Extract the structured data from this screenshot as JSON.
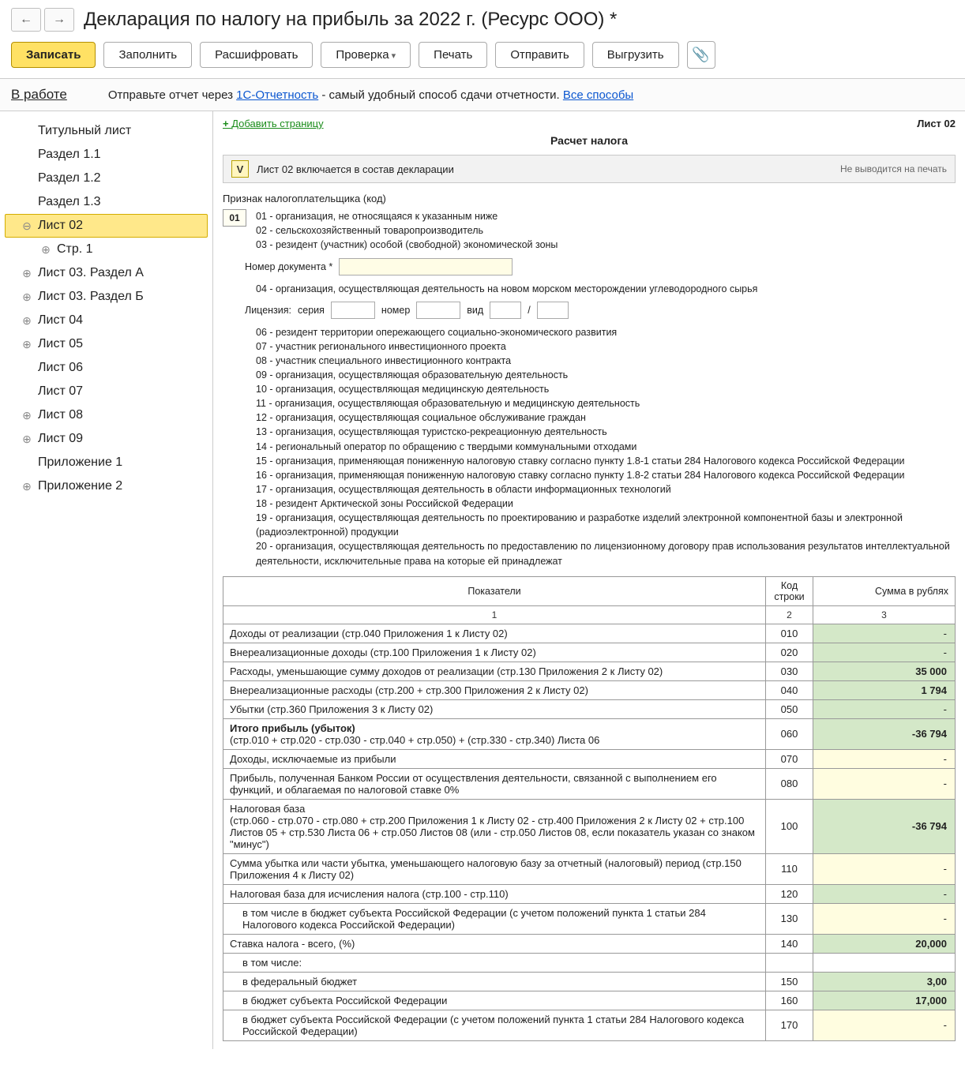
{
  "title": "Декларация по налогу на прибыль за 2022 г. (Ресурс ООО) *",
  "toolbar": {
    "write": "Записать",
    "fill": "Заполнить",
    "decode": "Расшифровать",
    "check": "Проверка",
    "print": "Печать",
    "send": "Отправить",
    "export": "Выгрузить"
  },
  "status": "В работе",
  "infobar": {
    "prefix": "Отправьте отчет через ",
    "link1": "1С-Отчетность",
    "middle": " - самый удобный способ сдачи отчетности. ",
    "link2": "Все способы"
  },
  "tree": [
    {
      "label": "Титульный лист",
      "exp": "",
      "lvl": 1
    },
    {
      "label": "Раздел 1.1",
      "exp": "",
      "lvl": 1
    },
    {
      "label": "Раздел 1.2",
      "exp": "",
      "lvl": 1
    },
    {
      "label": "Раздел 1.3",
      "exp": "",
      "lvl": 1
    },
    {
      "label": "Лист 02",
      "exp": "minus",
      "lvl": 1,
      "selected": true
    },
    {
      "label": "Стр. 1",
      "exp": "plus",
      "lvl": 2
    },
    {
      "label": "Лист 03. Раздел А",
      "exp": "plus",
      "lvl": 1
    },
    {
      "label": "Лист 03. Раздел Б",
      "exp": "plus",
      "lvl": 1
    },
    {
      "label": "Лист 04",
      "exp": "plus",
      "lvl": 1
    },
    {
      "label": "Лист 05",
      "exp": "plus",
      "lvl": 1
    },
    {
      "label": "Лист 06",
      "exp": "",
      "lvl": 1
    },
    {
      "label": "Лист 07",
      "exp": "",
      "lvl": 1
    },
    {
      "label": "Лист 08",
      "exp": "plus",
      "lvl": 1
    },
    {
      "label": "Лист 09",
      "exp": "plus",
      "lvl": 1
    },
    {
      "label": "Приложение 1",
      "exp": "",
      "lvl": 1
    },
    {
      "label": "Приложение 2",
      "exp": "plus",
      "lvl": 1
    }
  ],
  "main": {
    "addPage": "Добавить страницу",
    "sheet": "Лист 02",
    "calcTitle": "Расчет налога",
    "includeText": "Лист 02 включается в состав декларации",
    "noPrint": "Не выводится на печать",
    "taxpayerLabel": "Признак налогоплательщика (код)",
    "code": "01",
    "codeLines": [
      "01 - организация, не относящаяся к указанным ниже",
      "02 - сельскохозяйственный товаропроизводитель",
      "03 - резидент (участник) особой (свободной) экономической зоны"
    ],
    "docNumLabel": "Номер документа *",
    "line04": "04 - организация, осуществляющая деятельность на новом морском месторождении углеводородного сырья",
    "license": {
      "label": "Лицензия:",
      "series": "серия",
      "number": "номер",
      "type": "вид",
      "slash": "/"
    },
    "restLines": [
      "06 - резидент территории опережающего социально-экономического развития",
      "07 - участник регионального инвестиционного проекта",
      "08 - участник специального инвестиционного контракта",
      "09 - организация, осуществляющая образовательную деятельность",
      "10 - организация, осуществляющая медицинскую деятельность",
      "11 - организация, осуществляющая образовательную и медицинскую деятельность",
      "12 - организация, осуществляющая социальное обслуживание граждан",
      "13 - организация, осуществляющая туристско-рекреационную деятельность",
      "14 - региональный оператор по обращению с твердыми коммунальными отходами",
      "15 - организация, применяющая пониженную налоговую ставку согласно пункту 1.8-1 статьи 284 Налогового кодекса Российской Федерации",
      "16 - организация, применяющая пониженную налоговую ставку согласно пункту 1.8-2 статьи 284 Налогового кодекса Российской Федерации",
      "17 - организация, осуществляющая деятельность в области информационных технологий",
      "18 - резидент Арктической зоны Российской Федерации",
      "19 - организация, осуществляющая деятельность по проектированию и разработке изделий электронной компонентной базы и электронной (радиоэлектронной) продукции",
      "20 - организация, осуществляющая деятельность по предоставлению по лицензионному договору прав использования результатов интеллектуальной деятельности, исключительные права на которые ей принадлежат"
    ],
    "table": {
      "headers": {
        "ind": "Показатели",
        "code": "Код строки",
        "sum": "Сумма в рублях"
      },
      "sub": {
        "c1": "1",
        "c2": "2",
        "c3": "3"
      },
      "rows": [
        {
          "name": "Доходы от реализации (стр.040 Приложения 1 к Листу 02)",
          "code": "010",
          "sum": "-",
          "bg": "green"
        },
        {
          "name": "Внереализационные доходы (стр.100 Приложения 1 к Листу 02)",
          "code": "020",
          "sum": "-",
          "bg": "green"
        },
        {
          "name": "Расходы, уменьшающие сумму доходов от реализации (стр.130 Приложения 2 к Листу 02)",
          "code": "030",
          "sum": "35 000",
          "bg": "green",
          "bold": true
        },
        {
          "name": "Внереализационные расходы (стр.200 + стр.300 Приложения 2 к Листу 02)",
          "code": "040",
          "sum": "1 794",
          "bg": "green",
          "bold": true
        },
        {
          "name": "Убытки (стр.360 Приложения 3 к Листу 02)",
          "code": "050",
          "sum": "-",
          "bg": "green"
        },
        {
          "name": "Итого прибыль (убыток)\n(стр.010 + стр.020 - стр.030 - стр.040 + стр.050) + (стр.330 - стр.340) Листа 06",
          "code": "060",
          "sum": "-36 794",
          "bg": "green",
          "nameBold": true,
          "bold": true
        },
        {
          "name": "Доходы, исключаемые из прибыли",
          "code": "070",
          "sum": "-",
          "bg": "yellow"
        },
        {
          "name": "Прибыль, полученная Банком России от осуществления деятельности, связанной с выполнением его функций, и облагаемая по налоговой ставке 0%",
          "code": "080",
          "sum": "-",
          "bg": "yellow"
        },
        {
          "name": "Налоговая база\n(стр.060 - стр.070 - стр.080 + стр.200 Приложения 1 к Листу 02 - стр.400 Приложения 2 к Листу 02 + стр.100 Листов 05 + стр.530 Листа 06 + стр.050 Листов 08 (или - стр.050 Листов 08, если показатель указан со знаком \"минус\")",
          "code": "100",
          "sum": "-36 794",
          "bg": "green",
          "bold": true
        },
        {
          "name": "Сумма убытка или части убытка, уменьшающего налоговую базу за отчетный (налоговый) период (стр.150 Приложения 4 к Листу 02)",
          "code": "110",
          "sum": "-",
          "bg": "yellow"
        },
        {
          "name": "Налоговая база для исчисления налога (стр.100 - стр.110)",
          "code": "120",
          "sum": "-",
          "bg": "green"
        },
        {
          "name": "в том числе в бюджет субъекта Российской Федерации (с учетом положений пункта 1 статьи 284 Налогового кодекса Российской Федерации)",
          "code": "130",
          "sum": "-",
          "bg": "yellow",
          "indent": true
        },
        {
          "name": "Ставка налога - всего, (%)",
          "code": "140",
          "sum": "20,000",
          "bg": "green",
          "bold": true
        },
        {
          "name": "в том числе:",
          "code": "",
          "sum": "",
          "indent": true,
          "noSum": true
        },
        {
          "name": "в федеральный бюджет",
          "code": "150",
          "sum": "3,00",
          "bg": "green",
          "indent": true,
          "bold": true
        },
        {
          "name": "в бюджет субъекта Российской Федерации",
          "code": "160",
          "sum": "17,000",
          "bg": "green",
          "indent": true,
          "bold": true
        },
        {
          "name": "в бюджет субъекта Российской Федерации (с учетом положений пункта 1 статьи 284 Налогового кодекса Российской Федерации)",
          "code": "170",
          "sum": "-",
          "bg": "yellow",
          "indent": true
        }
      ]
    }
  }
}
